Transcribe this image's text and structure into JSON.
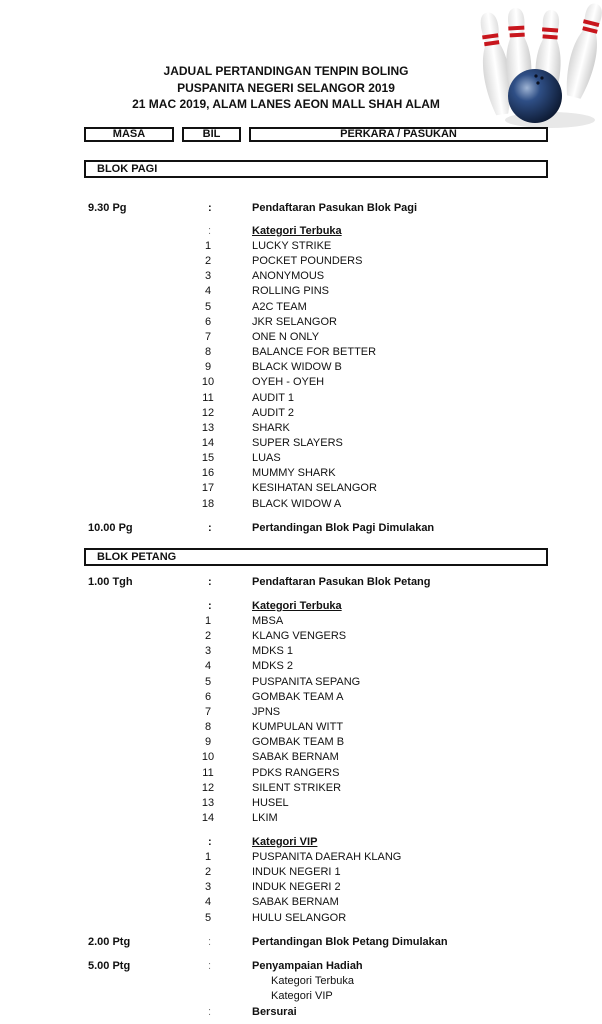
{
  "header": {
    "title_lines": [
      "JADUAL PERTANDINGAN TENPIN BOLING",
      "PUSPANITA NEGERI SELANGOR 2019",
      "21 MAC 2019, ALAM LANES AEON MALL SHAH ALAM"
    ],
    "logo_icon": "bowling-pins-and-ball"
  },
  "columns": [
    "MASA",
    "BIL",
    "PERKARA / PASUKAN"
  ],
  "blok_pagi": {
    "label": "BLOK PAGI",
    "registration": {
      "time": "9.30 Pg",
      "colon": ":",
      "text": "Pendaftaran Pasukan Blok Pagi"
    },
    "category": {
      "colon": ":",
      "label": "Kategori Terbuka"
    },
    "teams": [
      {
        "no": "1",
        "name": "LUCKY STRIKE"
      },
      {
        "no": "2",
        "name": "POCKET POUNDERS"
      },
      {
        "no": "3",
        "name": "ANONYMOUS"
      },
      {
        "no": "4",
        "name": "ROLLING PINS"
      },
      {
        "no": "5",
        "name": "A2C TEAM"
      },
      {
        "no": "6",
        "name": "JKR SELANGOR"
      },
      {
        "no": "7",
        "name": "ONE N ONLY"
      },
      {
        "no": "8",
        "name": "BALANCE FOR BETTER"
      },
      {
        "no": "9",
        "name": "BLACK WIDOW B"
      },
      {
        "no": "10",
        "name": "OYEH - OYEH"
      },
      {
        "no": "11",
        "name": "AUDIT 1"
      },
      {
        "no": "12",
        "name": "AUDIT 2"
      },
      {
        "no": "13",
        "name": "SHARK"
      },
      {
        "no": "14",
        "name": "SUPER SLAYERS"
      },
      {
        "no": "15",
        "name": "LUAS"
      },
      {
        "no": "16",
        "name": "MUMMY SHARK"
      },
      {
        "no": "17",
        "name": "KESIHATAN SELANGOR"
      },
      {
        "no": "18",
        "name": "BLACK WIDOW A"
      }
    ],
    "start": {
      "time": "10.00 Pg",
      "colon": ":",
      "text": "Pertandingan Blok Pagi Dimulakan"
    }
  },
  "blok_petang": {
    "label": "BLOK PETANG",
    "registration": {
      "time": "1.00 Tgh",
      "colon": ":",
      "text": "Pendaftaran Pasukan Blok Petang"
    },
    "category_terbuka": {
      "colon": ":",
      "label": "Kategori Terbuka"
    },
    "teams_terbuka": [
      {
        "no": "1",
        "name": "MBSA"
      },
      {
        "no": "2",
        "name": "KLANG VENGERS"
      },
      {
        "no": "3",
        "name": "MDKS 1"
      },
      {
        "no": "4",
        "name": "MDKS 2"
      },
      {
        "no": "5",
        "name": "PUSPANITA SEPANG"
      },
      {
        "no": "6",
        "name": "GOMBAK TEAM A"
      },
      {
        "no": "7",
        "name": "JPNS"
      },
      {
        "no": "8",
        "name": "KUMPULAN WITT"
      },
      {
        "no": "9",
        "name": "GOMBAK TEAM B"
      },
      {
        "no": "10",
        "name": "SABAK BERNAM"
      },
      {
        "no": "11",
        "name": "PDKS RANGERS"
      },
      {
        "no": "12",
        "name": "SILENT STRIKER"
      },
      {
        "no": "13",
        "name": "HUSEL"
      },
      {
        "no": "14",
        "name": "LKIM"
      }
    ],
    "category_vip": {
      "colon": ":",
      "label": "Kategori VIP"
    },
    "teams_vip": [
      {
        "no": "1",
        "name": "PUSPANITA DAERAH KLANG"
      },
      {
        "no": "2",
        "name": "INDUK NEGERI 1"
      },
      {
        "no": "3",
        "name": "INDUK NEGERI 2"
      },
      {
        "no": "4",
        "name": "SABAK BERNAM"
      },
      {
        "no": "5",
        "name": "HULU SELANGOR"
      }
    ],
    "start": {
      "time": "2.00 Ptg",
      "colon": ":",
      "text": "Pertandingan Blok Petang Dimulakan"
    },
    "prizes": {
      "time": "5.00 Ptg",
      "colon": ":",
      "text": "Penyampaian Hadiah",
      "items": [
        "Kategori Terbuka",
        "Kategori VIP"
      ]
    },
    "end": {
      "colon": ":",
      "text": "Bersurai"
    }
  }
}
